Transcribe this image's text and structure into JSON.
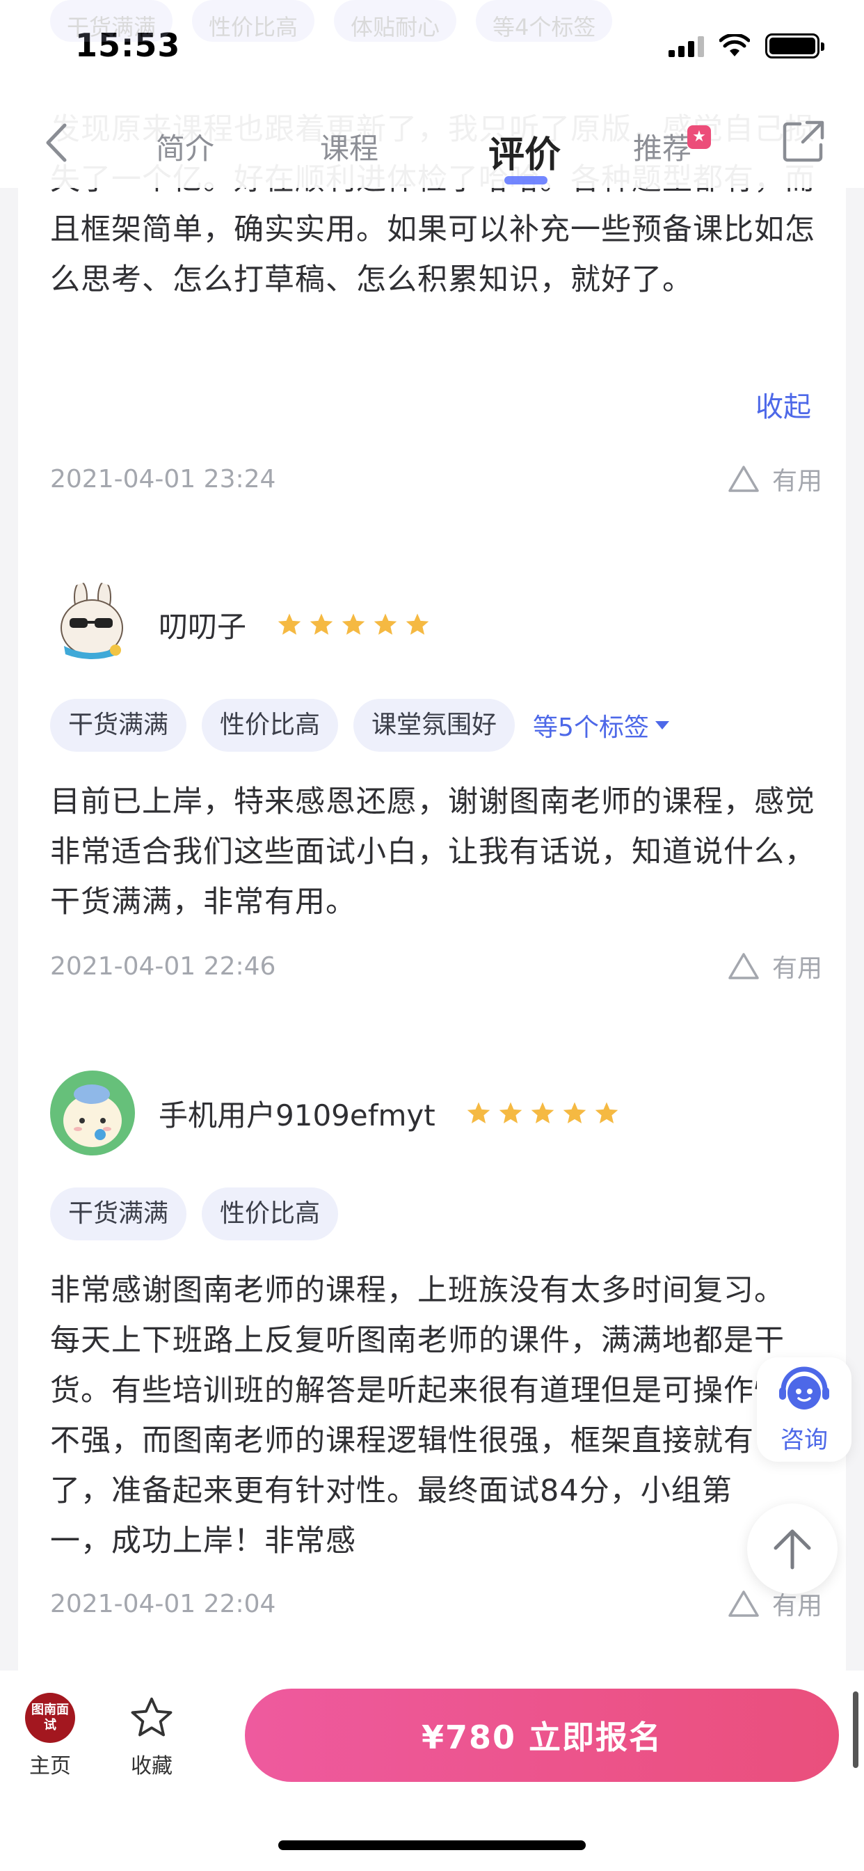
{
  "status": {
    "time": "15:53"
  },
  "ghost_tags": [
    "干货满满",
    "性价比高",
    "体贴耐心",
    "等4个标签"
  ],
  "nav": {
    "tabs": [
      {
        "label": "简介"
      },
      {
        "label": "课程"
      },
      {
        "label": "评价"
      },
      {
        "label": "推荐"
      }
    ],
    "active_tab": "评价",
    "accent_color": "#5a72ff",
    "badge_color": "#ec4d79"
  },
  "first_review": {
    "text": "发现原来课程也跟着更新了，我只听了原版，感觉自己损失了一个亿。好在顺利进体检了哈哈。各种题型都有，而且框架简单，确实实用。如果可以补充一些预备课比如怎么思考、怎么打草稿、怎么积累知识，就好了。",
    "collapse_label": "收起",
    "date": "2021-04-01 23:24",
    "useful_label": "有用"
  },
  "reviews": [
    {
      "user": "叨叨子",
      "rating": 5,
      "tags": [
        "干货满满",
        "性价比高",
        "课堂氛围好"
      ],
      "more_tags": "等5个标签",
      "text": "目前已上岸，特来感恩还愿，谢谢图南老师的课程，感觉非常适合我们这些面试小白，让我有话说，知道说什么，干货满满，非常有用。",
      "date": "2021-04-01 22:46",
      "useful_label": "有用"
    },
    {
      "user": "手机用户9109efmyt",
      "rating": 5,
      "tags": [
        "干货满满",
        "性价比高"
      ],
      "text": "非常感谢图南老师的课程，上班族没有太多时间复习。每天上下班路上反复听图南老师的课件，满满地都是干货。有些培训班的解答是听起来很有道理但是可操作性不强，而图南老师的课程逻辑性很强，框架直接就有了，准备起来更有针对性。最终面试84分，小组第一，成功上岸！非常感",
      "date": "2021-04-01 22:04",
      "useful_label": "有用"
    }
  ],
  "float": {
    "consult_label": "咨询"
  },
  "bottom": {
    "logo_text": "图南面试",
    "home_label": "主页",
    "fav_label": "收藏",
    "cta_label": "¥780  立即报名"
  }
}
